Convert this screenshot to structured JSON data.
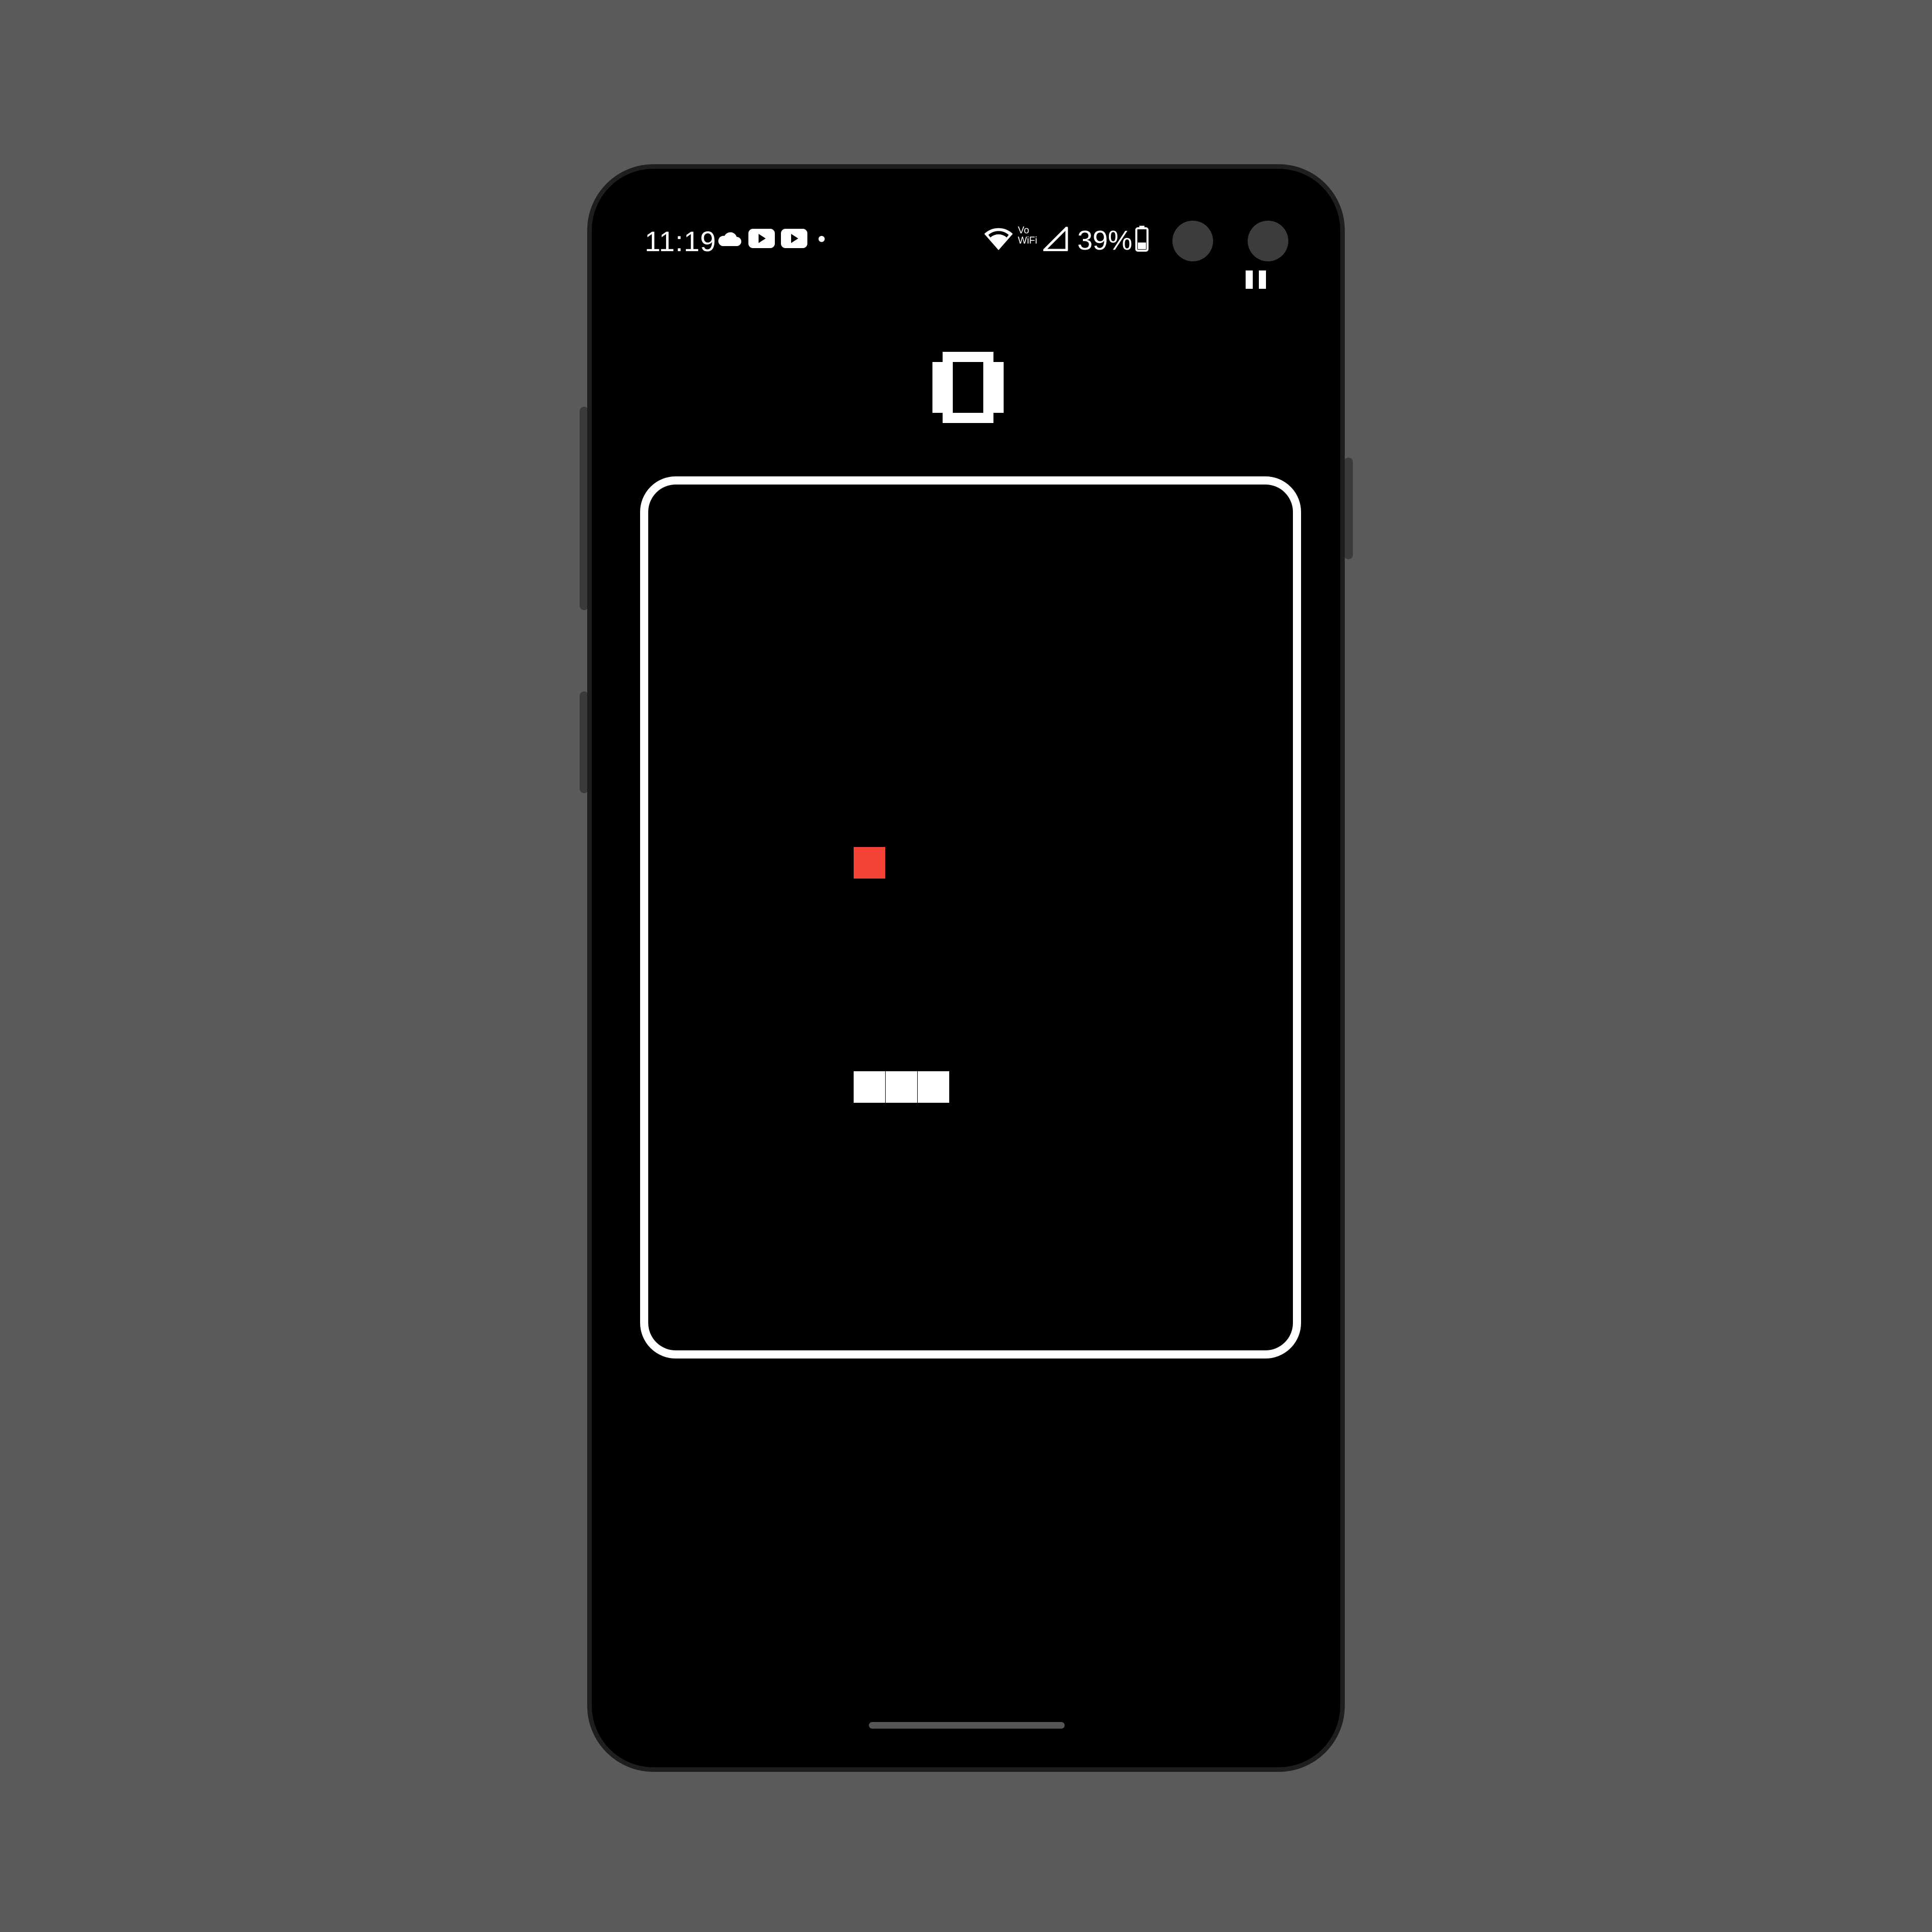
{
  "status_bar": {
    "time": "11:19",
    "left_icons": [
      "cloud-icon",
      "youtube-icon",
      "youtube-icon",
      "notification-dot-icon"
    ],
    "right_icons": [
      "wifi-icon",
      "vowifi-icon",
      "cell-signal-icon",
      "battery-icon"
    ],
    "vowifi_top": "Vo",
    "vowifi_bottom": "WiFi",
    "battery_percent": "39%"
  },
  "game": {
    "score": "0",
    "pause_icon": "pause-icon",
    "grid": {
      "cols": 20,
      "rows": 26
    },
    "food": {
      "col": 6,
      "row": 11,
      "color": "#f44336"
    },
    "snake": {
      "color": "#ffffff",
      "segments": [
        {
          "col": 6,
          "row": 18
        },
        {
          "col": 7,
          "row": 18
        },
        {
          "col": 8,
          "row": 18
        }
      ]
    }
  },
  "colors": {
    "background": "#5a5a5a",
    "screen": "#000000",
    "board_border": "#ffffff"
  }
}
